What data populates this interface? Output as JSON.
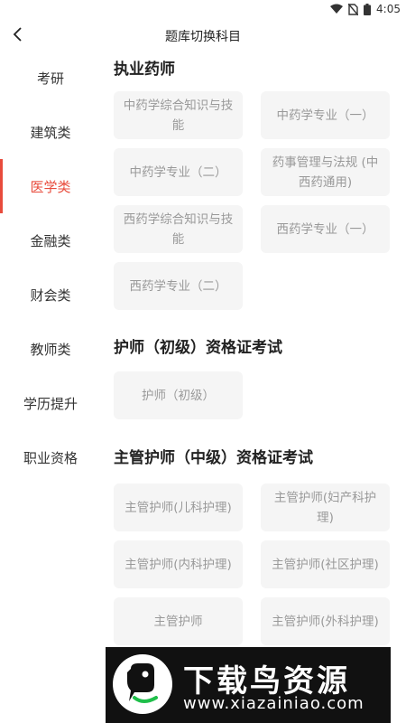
{
  "status_bar": {
    "time": "4:05",
    "icons": [
      "wifi-icon",
      "no-sim-icon",
      "battery-icon"
    ]
  },
  "nav": {
    "title": "题库切换科目",
    "back_icon": "chevron-left-icon"
  },
  "sidebar": {
    "items": [
      {
        "label": "考研",
        "active": false
      },
      {
        "label": "建筑类",
        "active": false
      },
      {
        "label": "医学类",
        "active": true
      },
      {
        "label": "金融类",
        "active": false
      },
      {
        "label": "财会类",
        "active": false
      },
      {
        "label": "教师类",
        "active": false
      },
      {
        "label": "学历提升",
        "active": false
      },
      {
        "label": "职业资格",
        "active": false
      }
    ]
  },
  "sections": [
    {
      "title": "执业药师",
      "cards": [
        "中药学综合知识与技能",
        "中药学专业（一）",
        "中药学专业（二）",
        "药事管理与法规 (中西药通用)",
        "西药学综合知识与技能",
        "西药学专业（一）",
        "西药学专业（二）"
      ]
    },
    {
      "title": "护师（初级）资格证考试",
      "cards": [
        "护师（初级）"
      ]
    },
    {
      "title": "主管护师（中级）资格证考试",
      "cards": [
        "主管护师(儿科护理)",
        "主管护师(妇产科护理)",
        "主管护师(内科护理)",
        "主管护师(社区护理)",
        "主管护师",
        "主管护师(外科护理)"
      ]
    }
  ],
  "watermark": {
    "text": "下载鸟资源",
    "url": "www.xiazainiao.com"
  },
  "colors": {
    "accent": "#e84b3c",
    "card_bg": "#f5f5f5",
    "card_text": "#999999"
  }
}
